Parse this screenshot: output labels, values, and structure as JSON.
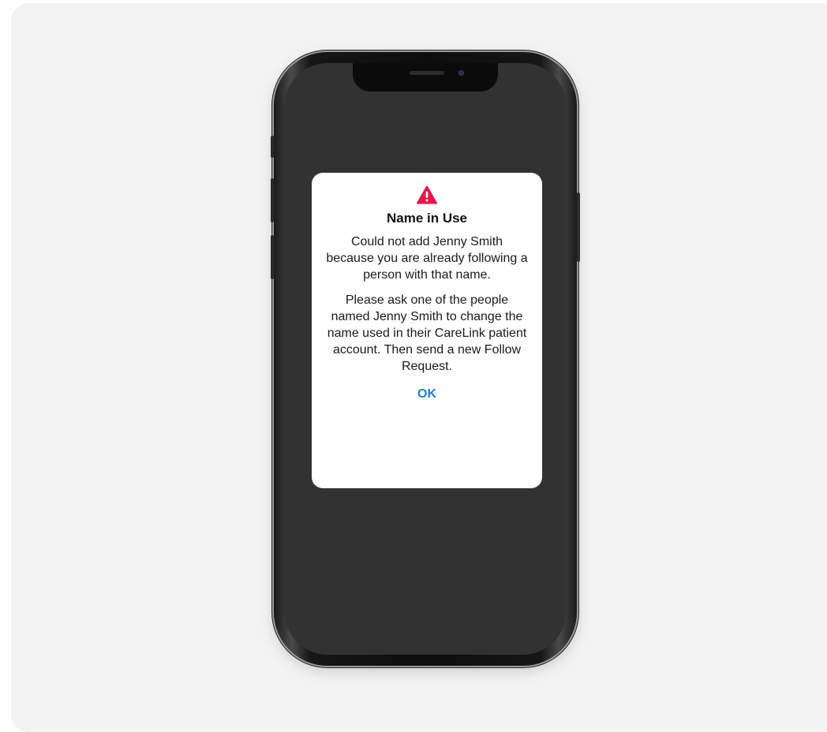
{
  "alert": {
    "icon": "warning-triangle-icon",
    "icon_color": "#e8154a",
    "title": "Name in Use",
    "message_1": "Could not add Jenny Smith because you are already following a person with that name.",
    "message_2": "Please ask one of the people named Jenny Smith to change the name used in their CareLink patient account. Then send a new Follow Request.",
    "ok_label": "OK",
    "ok_color": "#1a7fe0"
  },
  "device": {
    "screen_color": "#323232",
    "backdrop_color": "#f3f3f3"
  }
}
